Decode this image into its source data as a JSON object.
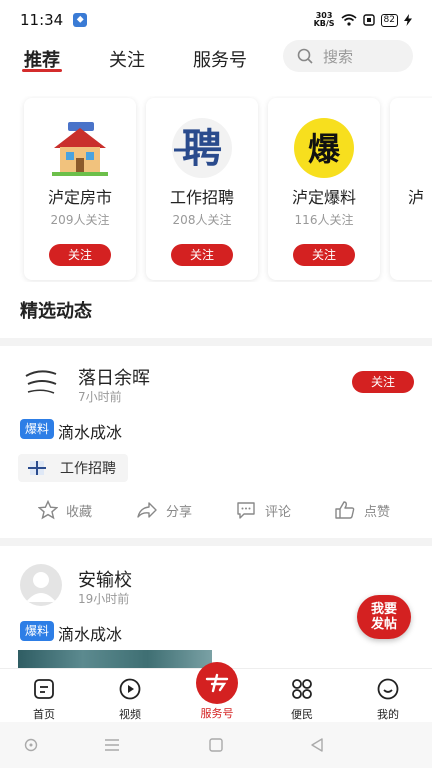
{
  "status_bar": {
    "time": "11:34",
    "net_speed_value": "303",
    "net_speed_unit": "KB/S",
    "battery": "82"
  },
  "top_tabs": [
    {
      "label": "推荐",
      "active": true
    },
    {
      "label": "关注",
      "active": false
    },
    {
      "label": "服务号",
      "active": false
    }
  ],
  "search": {
    "placeholder": "搜索"
  },
  "service_cards": [
    {
      "title": "泸定房市",
      "followers": "209人关注",
      "button": "关注",
      "icon": "house-icon"
    },
    {
      "title": "工作招聘",
      "followers": "208人关注",
      "button": "关注",
      "icon": "recruit-icon",
      "icon_text": "聘"
    },
    {
      "title": "泸定爆料",
      "followers": "116人关注",
      "button": "关注",
      "icon": "breaking-news-icon",
      "icon_text": "爆"
    },
    {
      "title": "泸",
      "followers": "",
      "button": ""
    }
  ],
  "section_title": "精选动态",
  "posts": [
    {
      "author": "落日余晖",
      "time": "7小时前",
      "follow": "关注",
      "tag": "爆料",
      "text": "滴水成冰",
      "chip": "工作招聘",
      "actions": {
        "favorite": "收藏",
        "share": "分享",
        "comment": "评论",
        "like": "点赞"
      }
    },
    {
      "author": "安输校",
      "time": "19小时前",
      "tag": "爆料",
      "text": "滴水成冰"
    }
  ],
  "fab": {
    "line1": "我要",
    "line2": "发帖"
  },
  "bottom_nav": [
    {
      "label": "首页",
      "icon": "home-icon"
    },
    {
      "label": "视频",
      "icon": "video-icon"
    },
    {
      "label": "服务号",
      "icon": "service-icon"
    },
    {
      "label": "便民",
      "icon": "grid-icon"
    },
    {
      "label": "我的",
      "icon": "profile-icon"
    }
  ],
  "colors": {
    "accent": "#d42121",
    "tag_blue": "#2d7ee6"
  }
}
